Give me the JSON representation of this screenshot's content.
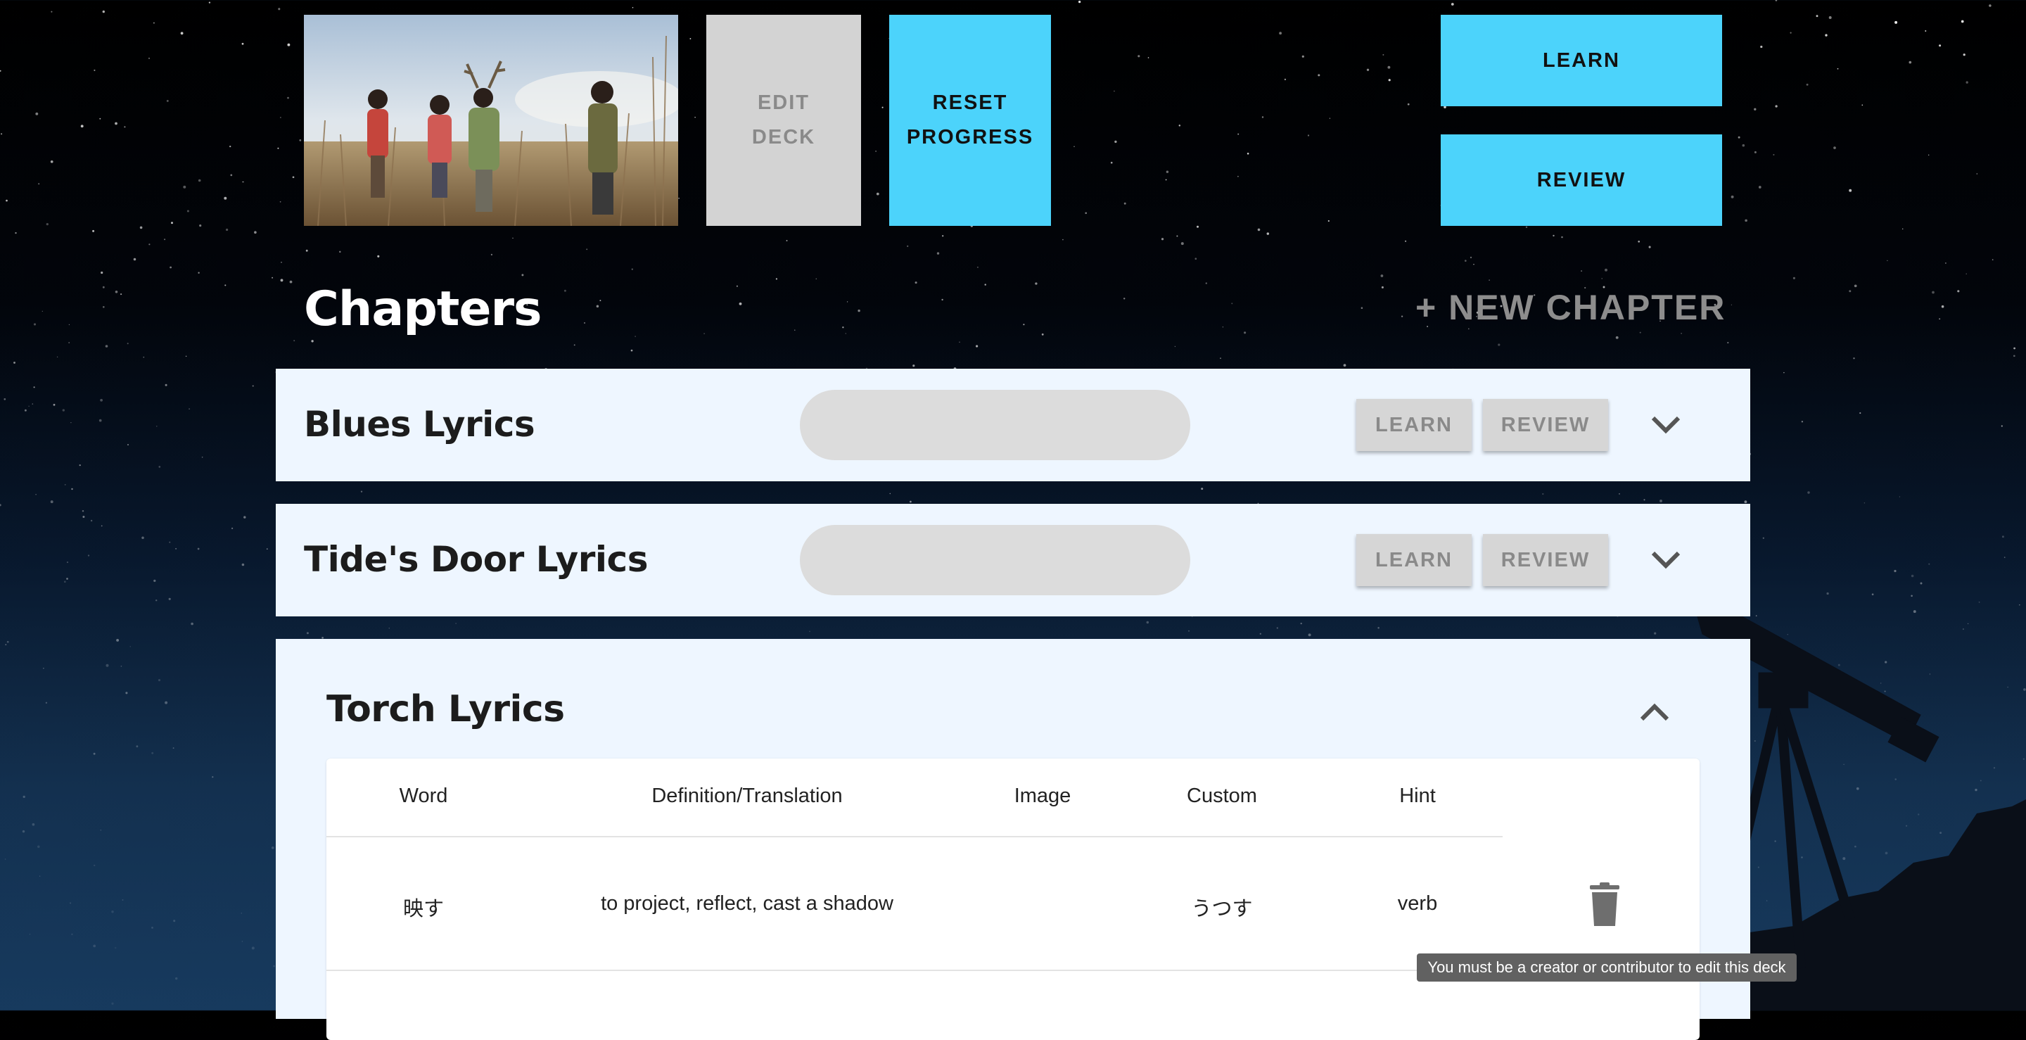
{
  "deck": {
    "edit_label_line1": "EDIT",
    "edit_label_line2": "DECK",
    "reset_label_line1": "RESET",
    "reset_label_line2": "PROGRESS",
    "learn_label": "LEARN",
    "review_label": "REVIEW"
  },
  "chapters_section": {
    "title": "Chapters",
    "new_chapter_label": "+ NEW CHAPTER"
  },
  "chapters": [
    {
      "name": "Blues Lyrics",
      "learn_label": "LEARN",
      "review_label": "REVIEW",
      "expanded": false
    },
    {
      "name": "Tide's Door Lyrics",
      "learn_label": "LEARN",
      "review_label": "REVIEW",
      "expanded": false
    },
    {
      "name": "Torch Lyrics",
      "expanded": true
    }
  ],
  "word_table": {
    "columns": [
      "Word",
      "Definition/Translation",
      "Image",
      "Custom",
      "Hint"
    ],
    "rows": [
      {
        "word": "映す",
        "definition": "to project, reflect, cast a shadow",
        "image": "",
        "custom": "うつす",
        "hint": "verb"
      }
    ]
  },
  "tooltip": "You must be a creator or contributor to edit this deck",
  "colors": {
    "accent": "#4cd3fb",
    "disabled_button": "#d3d3d3",
    "card_background": "#eef6ff",
    "muted_text": "#8a8a8a"
  },
  "icons": [
    "chevron-down-icon",
    "chevron-up-icon",
    "trash-icon"
  ]
}
